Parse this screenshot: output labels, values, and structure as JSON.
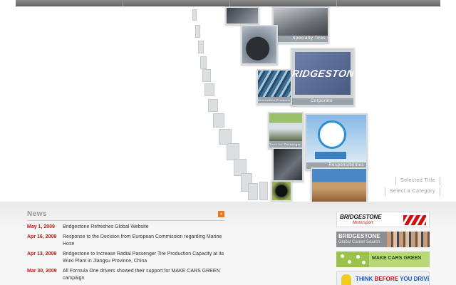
{
  "hero": {
    "tiles": {
      "specialty": "Specialty Tires",
      "corporate": "Corporate",
      "brand_logo": "BRIDGESTONE",
      "responsibilities": "Responsibilities",
      "small_a": "Tires for Passenger Cars",
      "small_b": "Diversified Products"
    },
    "select_title": "Selected Title",
    "select_category": "Select a Category"
  },
  "news": {
    "title": "News",
    "items": [
      {
        "date": "May 1, 2009",
        "text": "Bridgestone Refreshes Global Website"
      },
      {
        "date": "Apr 16, 2009",
        "text": "Response to the Decision from European Commission regarding Marine Hose"
      },
      {
        "date": "Apr 13, 2009",
        "text": "Bridgestone to Increase Radial Passenger Tire Production Capacity at its Wuxi Plant in Jiangsu Province, China"
      },
      {
        "date": "Mar 30, 2009",
        "text": "All Formula One drivers showed their support for MAKE CARS GREEN campaign"
      }
    ]
  },
  "banners": {
    "motorsport_title": "BRIDGESTONE",
    "motorsport_sub": "Motorsport",
    "career_title": "BRIDGESTONE",
    "career_sub": "Global Career Search",
    "green": "MAKE CARS GREEN",
    "think_a": "THINK ",
    "think_b": "BEFORE",
    "think_c": " YOU DRIVE"
  },
  "colors": {
    "accent_red": "#cc1111",
    "nav_gray": "#6b6b6b",
    "green": "#9cc24e"
  }
}
